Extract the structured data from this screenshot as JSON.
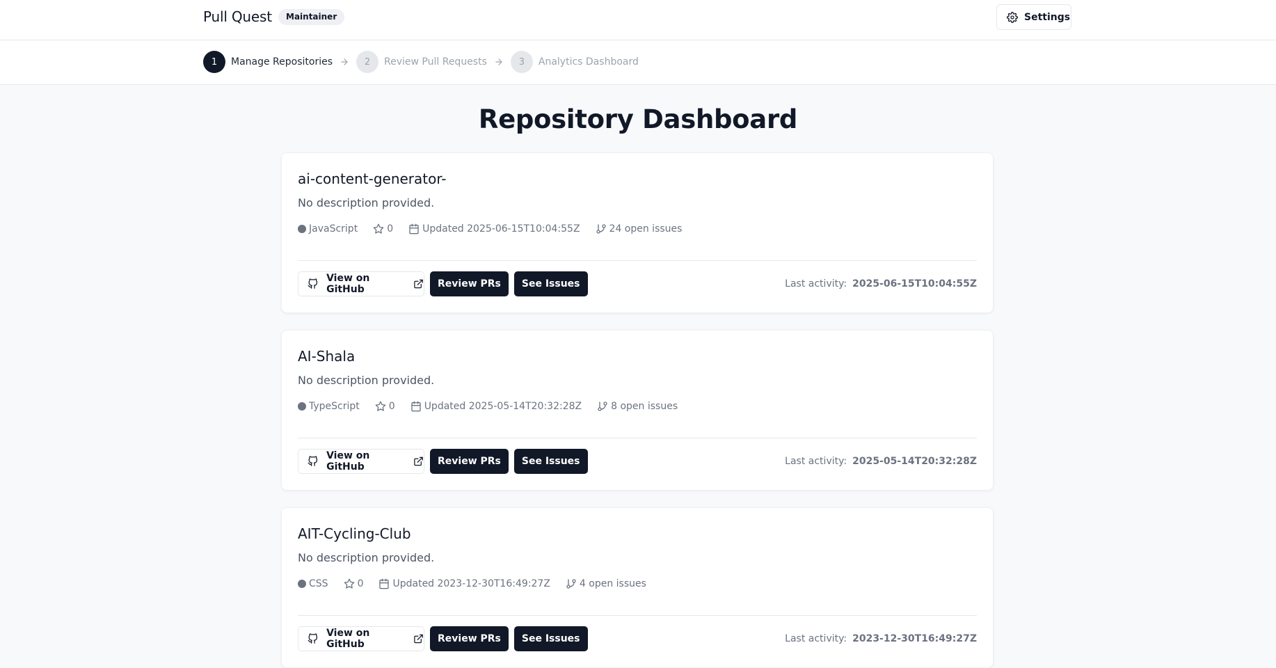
{
  "header": {
    "brand": "Pull Quest",
    "role_badge": "Maintainer",
    "settings_label": "Settings"
  },
  "steps": [
    {
      "number": "1",
      "label": "Manage Repositories",
      "active": true
    },
    {
      "number": "2",
      "label": "Review Pull Requests",
      "active": false
    },
    {
      "number": "3",
      "label": "Analytics Dashboard",
      "active": false
    }
  ],
  "page_title": "Repository Dashboard",
  "common": {
    "view_github": "View on GitHub",
    "review_prs": "Review PRs",
    "see_issues": "See Issues",
    "last_activity_label": "Last activity:"
  },
  "repos": [
    {
      "name": "ai-content-generator-",
      "description": "No description provided.",
      "language": "JavaScript",
      "stars": "0",
      "updated": "Updated 2025-06-15T10:04:55Z",
      "open_issues": "24 open issues",
      "last_activity": "2025-06-15T10:04:55Z"
    },
    {
      "name": "AI-Shala",
      "description": "No description provided.",
      "language": "TypeScript",
      "stars": "0",
      "updated": "Updated 2025-05-14T20:32:28Z",
      "open_issues": "8 open issues",
      "last_activity": "2025-05-14T20:32:28Z"
    },
    {
      "name": "AIT-Cycling-Club",
      "description": "No description provided.",
      "language": "CSS",
      "stars": "0",
      "updated": "Updated 2023-12-30T16:49:27Z",
      "open_issues": "4 open issues",
      "last_activity": "2023-12-30T16:49:27Z"
    }
  ],
  "colors": {
    "primary": "#111827",
    "muted_text": "#6b7280",
    "border": "#e5e7eb",
    "page_bg": "#f8f9fb"
  }
}
